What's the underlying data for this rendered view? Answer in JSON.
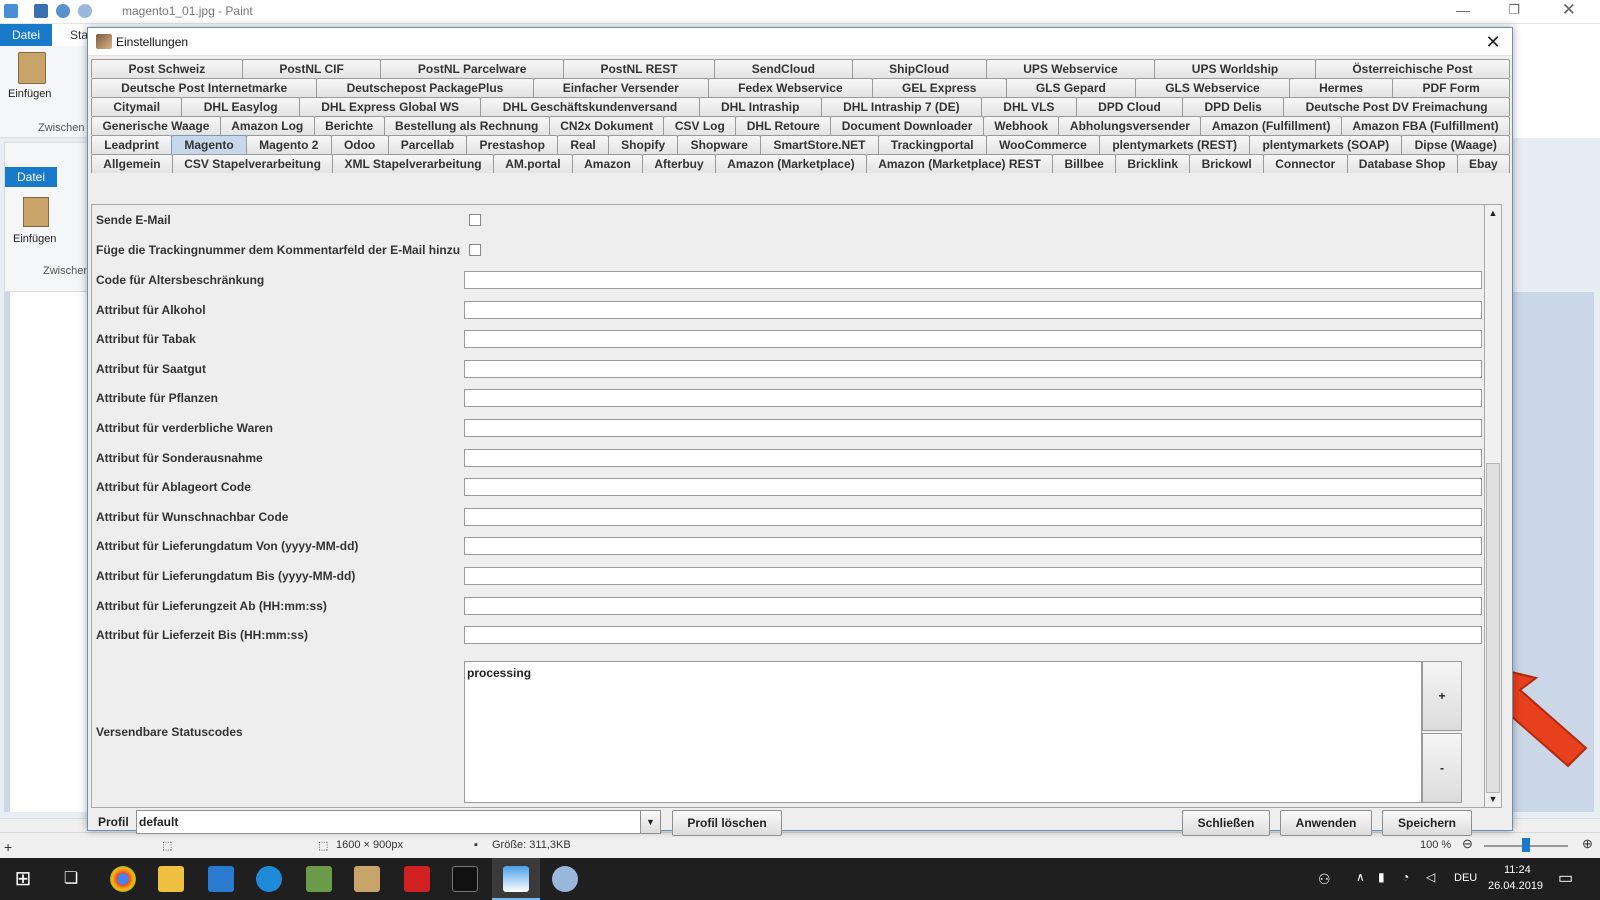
{
  "paint": {
    "window_title": "magento1_01.jpg - Paint",
    "tab_file": "Datei",
    "tab_start_partial": "Sta",
    "paste_label": "Einfügen",
    "clipboard_partial": "Zwischen",
    "status_size": "1600 × 900px",
    "status_filesize": "Größe: 311,3KB",
    "zoom": "100 %"
  },
  "taskbar": {
    "lang": "DEU",
    "time": "11:24",
    "date": "26.04.2019"
  },
  "dialog": {
    "title": "Einstellungen",
    "tab_rows": [
      [
        "Post Schweiz",
        "PostNL CIF",
        "PostNL Parcelware",
        "PostNL REST",
        "SendCloud",
        "ShipCloud",
        "UPS Webservice",
        "UPS Worldship",
        "Österreichische Post"
      ],
      [
        "Deutsche Post Internetmarke",
        "Deutschepost PackagePlus",
        "Einfacher Versender",
        "Fedex Webservice",
        "GEL Express",
        "GLS Gepard",
        "GLS Webservice",
        "Hermes",
        "PDF Form"
      ],
      [
        "Citymail",
        "DHL Easylog",
        "DHL Express Global WS",
        "DHL Geschäftskundenversand",
        "DHL Intraship",
        "DHL Intraship 7 (DE)",
        "DHL VLS",
        "DPD Cloud",
        "DPD Delis",
        "Deutsche Post DV Freimachung"
      ],
      [
        "Generische Waage",
        "Amazon Log",
        "Berichte",
        "Bestellung als Rechnung",
        "CN2x Dokument",
        "CSV Log",
        "DHL Retoure",
        "Document Downloader",
        "Webhook",
        "Abholungsversender",
        "Amazon (Fulfillment)",
        "Amazon FBA (Fulfillment)"
      ],
      [
        "Leadprint",
        "Magento",
        "Magento 2",
        "Odoo",
        "Parcellab",
        "Prestashop",
        "Real",
        "Shopify",
        "Shopware",
        "SmartStore.NET",
        "Trackingportal",
        "WooCommerce",
        "plentymarkets (REST)",
        "plentymarkets (SOAP)",
        "Dipse (Waage)"
      ],
      [
        "Allgemein",
        "CSV Stapelverarbeitung",
        "XML Stapelverarbeitung",
        "AM.portal",
        "Amazon",
        "Afterbuy",
        "Amazon (Marketplace)",
        "Amazon (Marketplace) REST",
        "Billbee",
        "Bricklink",
        "Brickowl",
        "Connector",
        "Database Shop",
        "Ebay"
      ]
    ],
    "selected_tab": "Magento",
    "fields": [
      {
        "label": "Sende E-Mail",
        "type": "checkbox",
        "checked": false
      },
      {
        "label": "Füge die Trackingnummer dem Kommentarfeld der E-Mail hinzu",
        "type": "checkbox",
        "checked": false
      },
      {
        "label": "Code für Altersbeschränkung",
        "type": "text",
        "value": ""
      },
      {
        "label": "Attribut für Alkohol",
        "type": "text",
        "value": ""
      },
      {
        "label": "Attribut für Tabak",
        "type": "text",
        "value": ""
      },
      {
        "label": "Attribut für Saatgut",
        "type": "text",
        "value": ""
      },
      {
        "label": "Attribute für Pflanzen",
        "type": "text",
        "value": ""
      },
      {
        "label": "Attribut für verderbliche Waren",
        "type": "text",
        "value": ""
      },
      {
        "label": "Attribut für Sonderausnahme",
        "type": "text",
        "value": ""
      },
      {
        "label": "Attribut für Ablageort Code",
        "type": "text",
        "value": ""
      },
      {
        "label": "Attribut für Wunschnachbar Code",
        "type": "text",
        "value": ""
      },
      {
        "label": "Attribut für Lieferungdatum Von (yyyy-MM-dd)",
        "type": "text",
        "value": ""
      },
      {
        "label": "Attribut für Lieferungdatum Bis (yyyy-MM-dd)",
        "type": "text",
        "value": ""
      },
      {
        "label": "Attribut für Lieferungzeit Ab (HH:mm:ss)",
        "type": "text",
        "value": ""
      },
      {
        "label": "Attribut für Lieferzeit Bis (HH:mm:ss)",
        "type": "text",
        "value": ""
      }
    ],
    "status_codes_label": "Versendbare Statuscodes",
    "status_codes": [
      "processing"
    ],
    "add_button": "+",
    "remove_button": "-",
    "profile_label": "Profil",
    "profile_value": "default",
    "delete_profile": "Profil löschen",
    "close_button": "Schließen",
    "apply_button": "Anwenden",
    "save_button": "Speichern"
  },
  "colors": {
    "accent": "#1979ca",
    "arrow": "#e8401c",
    "selected_tab": "#c9d7ea"
  }
}
